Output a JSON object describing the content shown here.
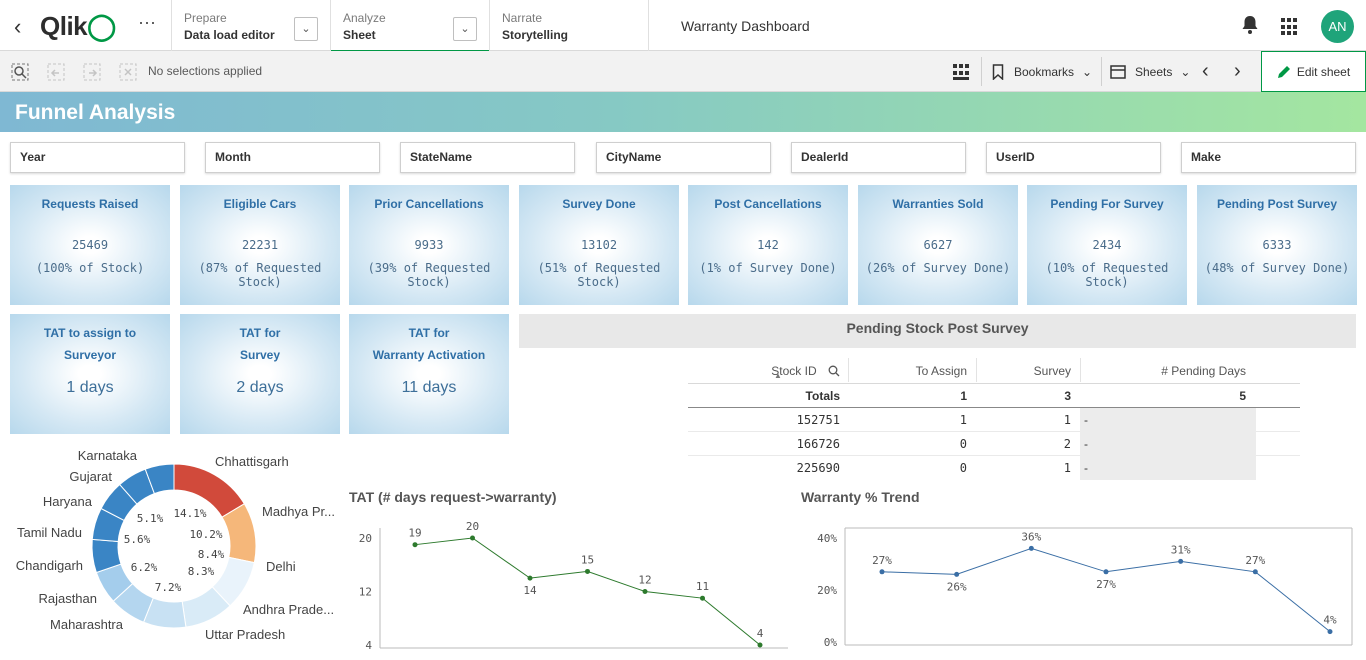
{
  "nav": {
    "prepare": {
      "label": "Prepare",
      "value": "Data load editor"
    },
    "analyze": {
      "label": "Analyze",
      "value": "Sheet"
    },
    "narrate": {
      "label": "Narrate",
      "value": "Storytelling"
    },
    "app_title": "Warranty Dashboard",
    "avatar_initials": "AN",
    "brand_green": "#009845"
  },
  "toolbar": {
    "selections": "No selections applied",
    "bookmarks": "Bookmarks",
    "sheets": "Sheets",
    "edit": "Edit sheet"
  },
  "sheet": {
    "title": "Funnel Analysis"
  },
  "filters": [
    "Year",
    "Month",
    "StateName",
    "CityName",
    "DealerId",
    "UserID",
    "Make"
  ],
  "kpis": [
    {
      "title": "Requests Raised",
      "value": "25469",
      "sub": "(100% of Stock)"
    },
    {
      "title": "Eligible Cars",
      "value": "22231",
      "sub": "(87% of Requested Stock)"
    },
    {
      "title": "Prior Cancellations",
      "value": "9933",
      "sub": "(39% of Requested Stock)"
    },
    {
      "title": "Survey Done",
      "value": "13102",
      "sub": "(51% of Requested Stock)"
    },
    {
      "title": "Post Cancellations",
      "value": "142",
      "sub": "(1% of Survey Done)"
    },
    {
      "title": "Warranties Sold",
      "value": "6627",
      "sub": "(26% of Survey Done)"
    },
    {
      "title": "Pending For Survey",
      "value": "2434",
      "sub": "(10% of Requested Stock)"
    },
    {
      "title": "Pending Post Survey",
      "value": "6333",
      "sub": "(48% of Survey Done)"
    }
  ],
  "tat_kpis": [
    {
      "line1": "TAT to assign to",
      "line2": "Surveyor",
      "value": "1 days"
    },
    {
      "line1": "TAT for",
      "line2": "Survey",
      "value": "2 days"
    },
    {
      "line1": "TAT for",
      "line2": "Warranty Activation",
      "value": "11 days"
    }
  ],
  "pending": {
    "title": "Pending Stock Post Survey",
    "columns": [
      "Stock ID",
      "To Assign",
      "Survey",
      "# Pending Days"
    ],
    "totals": {
      "label": "Totals",
      "to_assign": "1",
      "survey": "3",
      "pending_days": "5"
    },
    "rows": [
      {
        "id": "152751",
        "to_assign": "1",
        "survey": "1",
        "pending_days": "-"
      },
      {
        "id": "166726",
        "to_assign": "0",
        "survey": "2",
        "pending_days": "-"
      },
      {
        "id": "225690",
        "to_assign": "0",
        "survey": "1",
        "pending_days": "-"
      }
    ]
  },
  "chart_data": [
    {
      "type": "pie",
      "title": "",
      "slices": [
        {
          "label": "Chhattisgarh",
          "value": 14.1,
          "color": "#d14a3b"
        },
        {
          "label": "Madhya Pr...",
          "value": 10.2,
          "color": "#f5b77a"
        },
        {
          "label": "Delhi",
          "value": 8.4,
          "color": "#e9f3fb"
        },
        {
          "label": "Andhra Prade...",
          "value": 8.3,
          "color": "#d9ebf7"
        },
        {
          "label": "Uttar Pradesh",
          "value": 7.2,
          "color": "#c8e1f3"
        },
        {
          "label": "Maharashtra",
          "value": 6.2,
          "color": "#b4d6ef"
        },
        {
          "label": "Rajasthan",
          "value": 5.6,
          "color": "#a4cdec"
        },
        {
          "label": "Chandigarh",
          "value": 5.6,
          "color": "#3a85c5"
        },
        {
          "label": "Tamil Nadu",
          "value": 5.4,
          "color": "#3a85c5"
        },
        {
          "label": "Haryana",
          "value": 5.1,
          "color": "#3a85c5"
        },
        {
          "label": "Gujarat",
          "value": 5.0,
          "color": "#3a85c5"
        },
        {
          "label": "Karnataka",
          "value": 4.9,
          "color": "#3a85c5"
        }
      ],
      "visible_labels": [
        "14.1%",
        "10.2%",
        "8.4%",
        "8.3%",
        "7.2%",
        "6.2%",
        "5.6%",
        "5.1%"
      ]
    },
    {
      "type": "line",
      "title": "TAT (# days request->warranty)",
      "values": [
        19,
        20,
        14,
        15,
        12,
        11,
        4
      ],
      "yticks": [
        "20",
        "12",
        "4"
      ],
      "ylim": [
        4,
        20
      ],
      "color": "#2d7a2d"
    },
    {
      "type": "line",
      "title": "Warranty % Trend",
      "values": [
        27,
        26,
        36,
        27,
        31,
        27,
        4
      ],
      "labels": [
        "27%",
        "26%",
        "36%",
        "27%",
        "31%",
        "27%",
        "4%"
      ],
      "yticks": [
        "40%",
        "20%",
        "0%"
      ],
      "ylim": [
        0,
        40
      ],
      "color": "#3a6ea5"
    }
  ]
}
